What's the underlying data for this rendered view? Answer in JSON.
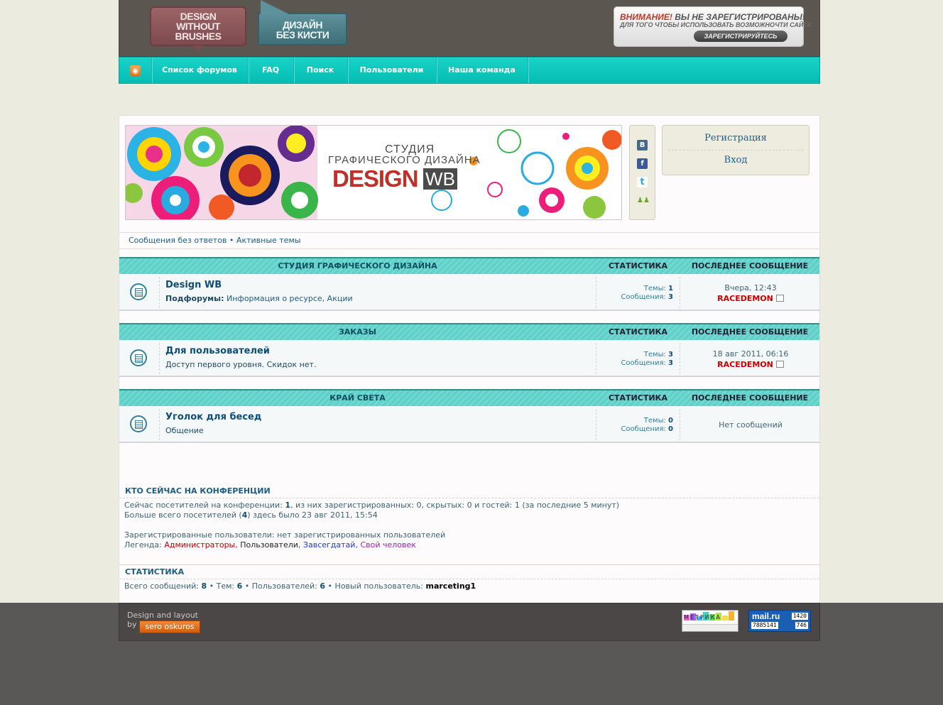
{
  "header": {
    "logo_en": "DESIGN\nWITHOUT\nBRUSHES",
    "logo_ru": "ДИЗАЙН\nБЕЗ КИСТИ",
    "warning_title_red": "ВНИМАНИЕ!",
    "warning_title_rest": "ВЫ НЕ ЗАРЕГИСТРИРОВАНЫ!",
    "warning_subtitle": "ДЛЯ ТОГО ЧТОБЫ ИСПОЛЬЗОВАТЬ ВОЗМОЖНОЧТИ САЙТА",
    "register_button": "ЗАРЕГИСТРИРУЙТЕСЬ"
  },
  "nav": {
    "rss_icon": "rss-icon",
    "items": [
      "Список форумов",
      "FAQ",
      "Поиск",
      "Пользователи",
      "Наша команда"
    ]
  },
  "banner": {
    "line1": "СТУДИЯ",
    "line2": "ГРАФИЧЕСКОГО ДИЗАЙНА",
    "design": "DESIGN",
    "wb": "WB"
  },
  "social": {
    "vk": "В",
    "fb": "f",
    "tw": "t",
    "friends": "♟♟"
  },
  "auth": {
    "register": "Регистрация",
    "login": "Вход"
  },
  "quick_links": {
    "unanswered": "Сообщения без ответов",
    "sep": "•",
    "active": "Активные темы"
  },
  "categories": [
    {
      "title": "СТУДИЯ ГРАФИЧЕСКОГО ДИЗАЙНА",
      "stats_header": "СТАТИСТИКА",
      "last_header": "ПОСЛЕДНЕЕ СООБЩЕНИЕ",
      "forum": {
        "name": "Design WB",
        "sub_label": "Подфорумы:",
        "sub1": "Информация о ресурсе",
        "sub_sep": ", ",
        "sub2": "Акции",
        "topics_label": "Темы:",
        "topics": "1",
        "posts_label": "Сообщения:",
        "posts": "3",
        "last_date": "Вчера, 12:43",
        "last_user": "RACEDEMON"
      }
    },
    {
      "title": "ЗАКАЗЫ",
      "stats_header": "СТАТИСТИКА",
      "last_header": "ПОСЛЕДНЕЕ СООБЩЕНИЕ",
      "forum": {
        "name": "Для пользователей",
        "desc": "Доступ первого уровня. Скидок нет.",
        "topics_label": "Темы:",
        "topics": "3",
        "posts_label": "Сообщения:",
        "posts": "3",
        "last_date": "18 авг 2011, 06:16",
        "last_user": "RACEDEMON"
      }
    },
    {
      "title": "КРАЙ СВЕТА",
      "stats_header": "СТАТИСТИКА",
      "last_header": "ПОСЛЕДНЕЕ СООБЩЕНИЕ",
      "forum": {
        "name": "Уголок для бесед",
        "desc": "Общение",
        "topics_label": "Темы:",
        "topics": "0",
        "posts_label": "Сообщения:",
        "posts": "0",
        "no_posts": "Нет сообщений"
      }
    }
  ],
  "online": {
    "title": "КТО СЕЙЧАС НА КОНФЕРЕНЦИИ",
    "line1_a": "Сейчас посетителей на конференции: ",
    "line1_total": "1",
    "line1_b": ", из них зарегистрированных: 0, скрытых: 0 и гостей: 1 (за последние 5 минут)",
    "line2_a": "Больше всего посетителей (",
    "line2_max": "4",
    "line2_b": ") здесь было 23 авг 2011, 15:54",
    "registered": "Зарегистрированные пользователи: нет зарегистрированных пользователей",
    "legend_label": "Легенда: ",
    "legend_admins": "Администраторы",
    "legend_users": "Пользователи",
    "legend_regulars": "Завсегдатай",
    "legend_own": "Свой человек",
    "legend_sep": ", ",
    "colors": {
      "admins": "#c00000",
      "users": "#222222",
      "regulars": "#1d3bd6",
      "own": "#a020c0"
    }
  },
  "statistics": {
    "title": "СТАТИСТИКА",
    "posts_label": "Всего сообщений: ",
    "posts": "8",
    "topics_label": " • Тем: ",
    "topics": "6",
    "users_label": " • Пользователей: ",
    "users": "6",
    "newest_label": " • Новый пользователь: ",
    "newest": "marceting1"
  },
  "footer": {
    "line1": "Design and layout",
    "line2": "by",
    "author": "sero oskuros",
    "metrika_label": "МЕТРИКА",
    "mailru_logo": "mail.ru",
    "mailru_n1": "1420",
    "mailru_n2": "7885141",
    "mailru_n3": "746"
  },
  "colors": {
    "nav_teal": "#05bdb3",
    "header_brown": "#5b5650",
    "cat_teal": "#5fcfc7",
    "user_red": "#c00000"
  }
}
